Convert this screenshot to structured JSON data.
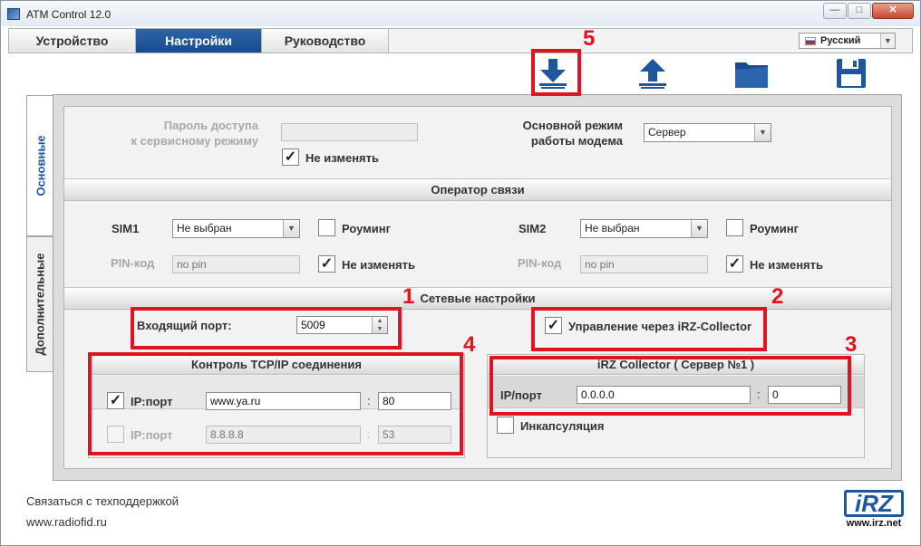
{
  "window": {
    "title": "ATM Control 12.0",
    "minimize_label": "—",
    "maximize_label": "□",
    "close_label": "✕"
  },
  "tabs": [
    {
      "label": "Устройство",
      "active": false
    },
    {
      "label": "Настройки",
      "active": true
    },
    {
      "label": "Руководство",
      "active": false
    }
  ],
  "language": {
    "selected": "Русский"
  },
  "toolbar": {
    "icons": [
      "download-icon",
      "upload-icon",
      "folder-icon",
      "save-icon"
    ]
  },
  "side_tabs": {
    "main": "Основные",
    "extra": "Дополнительные"
  },
  "general": {
    "password_label_line1": "Пароль доступа",
    "password_label_line2": "к сервисному режиму",
    "password_value": "",
    "no_change_label": "Не изменять",
    "no_change_checked": true,
    "mode_label_line1": "Основной режим",
    "mode_label_line2": "работы модема",
    "mode_value": "Сервер"
  },
  "operator": {
    "header": "Оператор связи",
    "sim1": {
      "label": "SIM1",
      "value": "Не выбран",
      "roaming_label": "Роуминг",
      "roaming_checked": false,
      "pin_label": "PIN-код",
      "pin_placeholder": "no pin",
      "no_change_label": "Не изменять",
      "no_change_checked": true
    },
    "sim2": {
      "label": "SIM2",
      "value": "Не выбран",
      "roaming_label": "Роуминг",
      "roaming_checked": false,
      "pin_label": "PIN-код",
      "pin_placeholder": "no pin",
      "no_change_label": "Не изменять",
      "no_change_checked": true
    }
  },
  "network": {
    "header": "Сетевые настройки",
    "incoming_port_label": "Входящий порт:",
    "incoming_port_value": "5009",
    "collector_control_label": "Управление через iRZ-Collector",
    "collector_control_checked": true,
    "tcp": {
      "header": "Контроль TCP/IP соединения",
      "rows": [
        {
          "checked": true,
          "label": "IP:порт",
          "ip": "www.ya.ru",
          "port": "80",
          "disabled": false
        },
        {
          "checked": false,
          "label": "IP:порт",
          "ip": "8.8.8.8",
          "port": "53",
          "disabled": true
        }
      ]
    },
    "collector": {
      "header": "iRZ Collector ( Сервер №1 )",
      "ip_label": "IP/порт",
      "ip_value": "0.0.0.0",
      "port_value": "0",
      "encapsulation_label": "Инкапсуляция",
      "encapsulation_checked": false
    }
  },
  "annotations": [
    "1",
    "2",
    "3",
    "4",
    "5"
  ],
  "footer": {
    "support_link": "Связаться с техподдержкой",
    "site_link": "www.radiofid.ru",
    "logo_text": "iRZ",
    "logo_url": "www.irz.net"
  },
  "colors": {
    "accent": "#1f56a0",
    "annotation_red": "#e0141e"
  }
}
